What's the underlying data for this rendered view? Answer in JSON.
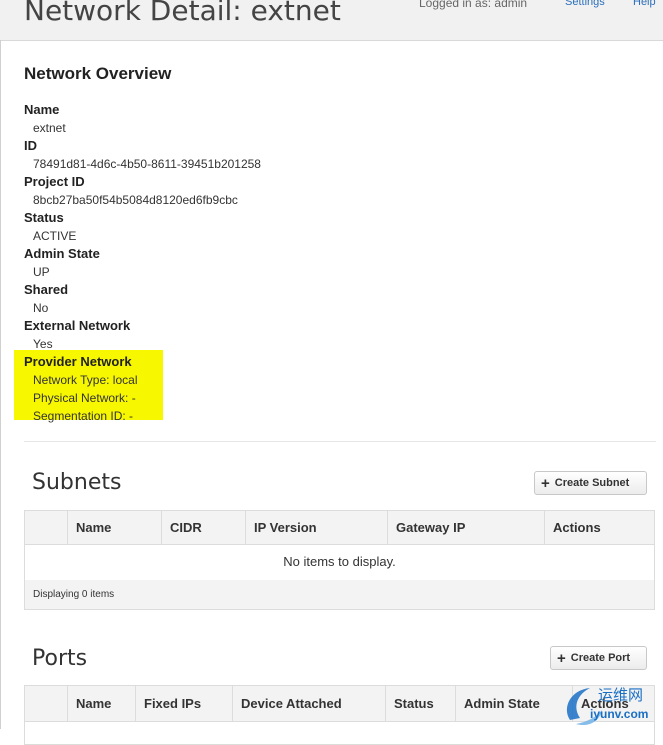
{
  "header": {
    "title": "Network Detail: extnet",
    "logged_in": "Logged in as: admin",
    "settings": "Settings",
    "help": "Help"
  },
  "overview": {
    "heading": "Network Overview",
    "fields": [
      {
        "label": "Name",
        "value": "extnet"
      },
      {
        "label": "ID",
        "value": "78491d81-4d6c-4b50-8611-39451b201258"
      },
      {
        "label": "Project ID",
        "value": "8bcb27ba50f54b5084d8120ed6fb9cbc"
      },
      {
        "label": "Status",
        "value": "ACTIVE"
      },
      {
        "label": "Admin State",
        "value": "UP"
      },
      {
        "label": "Shared",
        "value": "No"
      },
      {
        "label": "External Network",
        "value": "Yes"
      }
    ],
    "provider": {
      "label": "Provider Network",
      "network_type": "Network Type: local",
      "physical_network": "Physical Network: -",
      "segmentation_id": "Segmentation ID: -"
    }
  },
  "subnets": {
    "title": "Subnets",
    "create_label": "Create Subnet",
    "columns": [
      "Name",
      "CIDR",
      "IP Version",
      "Gateway IP",
      "Actions"
    ],
    "empty_message": "No items to display.",
    "footer": "Displaying 0 items"
  },
  "ports": {
    "title": "Ports",
    "create_label": "Create Port",
    "columns": [
      "Name",
      "Fixed IPs",
      "Device Attached",
      "Status",
      "Admin State",
      "Actions"
    ]
  },
  "watermark": {
    "text_cn": "运维网",
    "text_url": "iyunv.com"
  },
  "colors": {
    "highlight": "#f7f700",
    "link": "#2a6ebb",
    "watermark_blue": "#1a6fc4"
  }
}
